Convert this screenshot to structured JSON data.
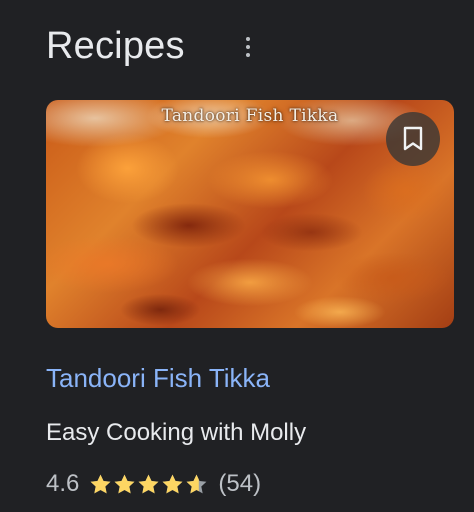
{
  "header": {
    "title": "Recipes",
    "more_icon": "more-vert-icon"
  },
  "card": {
    "image": {
      "caption": "Tandoori Fish Tikka",
      "save_icon": "bookmark-icon"
    },
    "title": "Tandoori Fish Tikka",
    "source": "Easy Cooking with Molly",
    "rating": {
      "value": "4.6",
      "stars": 4.6,
      "max_stars": 5,
      "count": "(54)"
    }
  },
  "colors": {
    "background": "#202124",
    "link": "#8ab4f8",
    "star": "#fdd663",
    "star_empty": "#9aa0a6",
    "text_primary": "#e8eaed",
    "text_secondary": "#bdc1c6"
  }
}
